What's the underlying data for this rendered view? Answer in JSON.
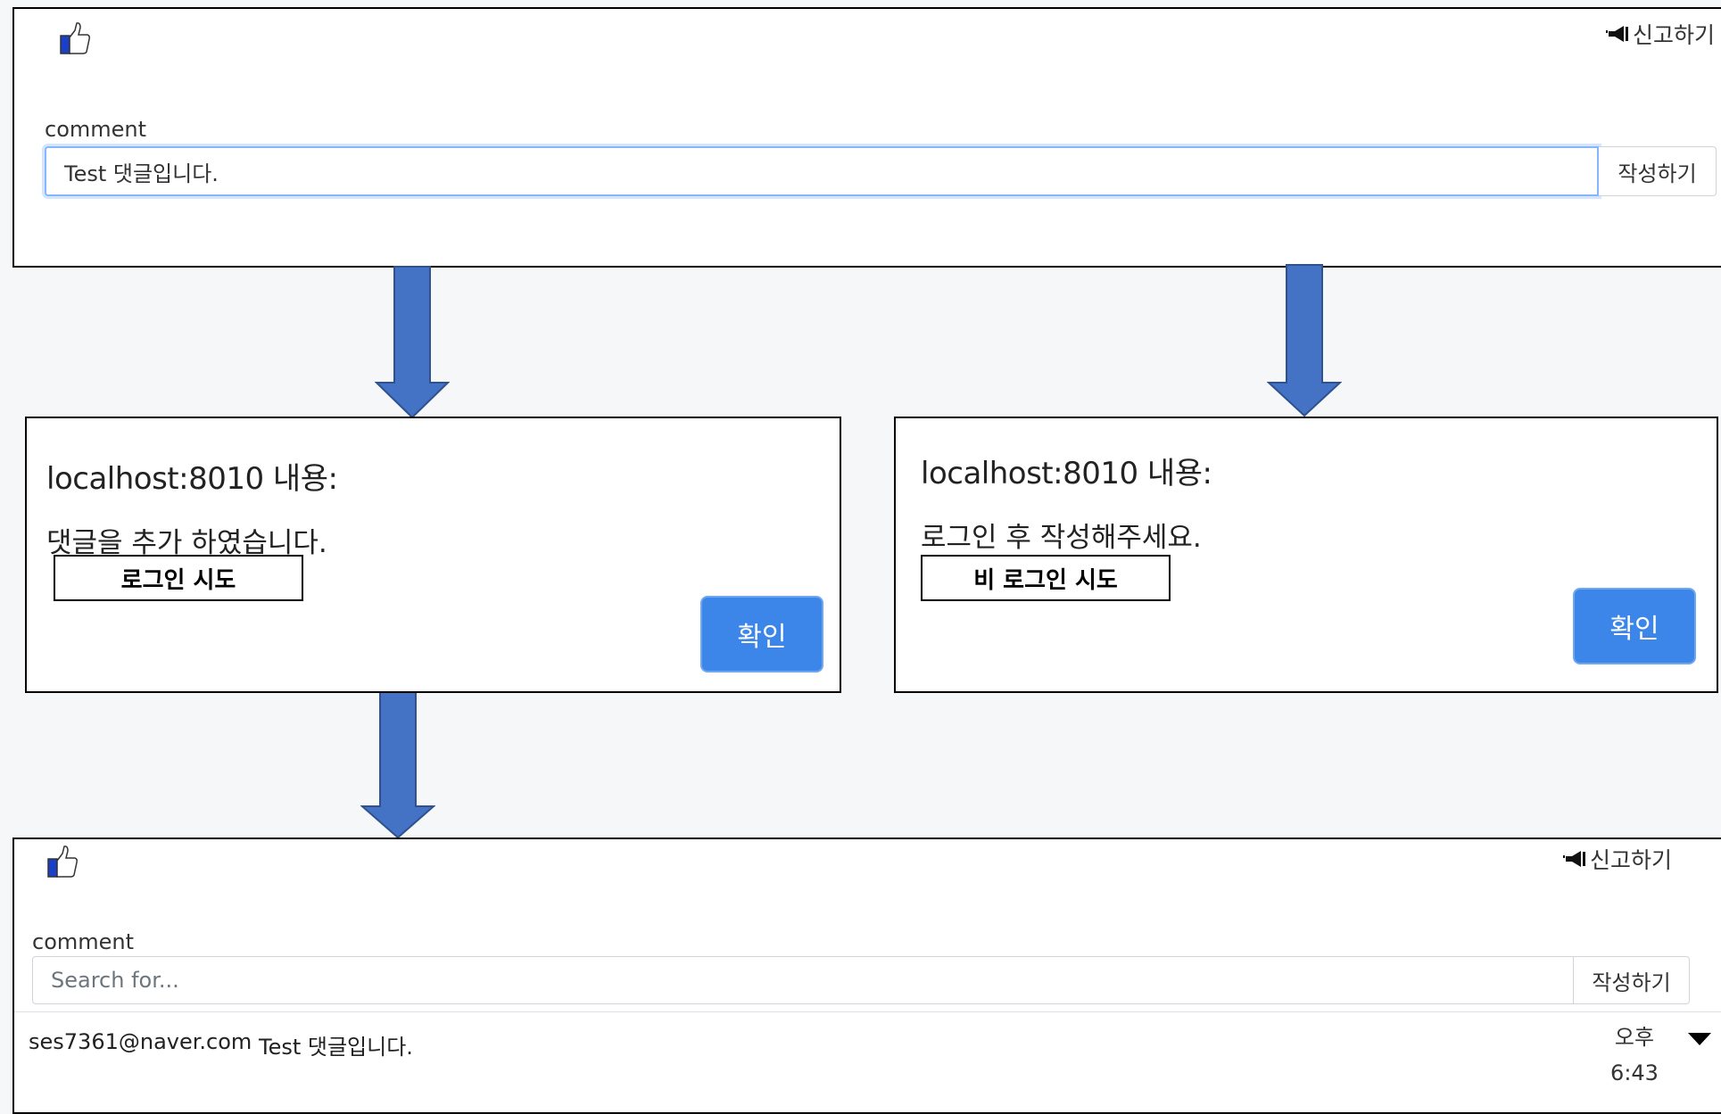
{
  "top_panel": {
    "report_label": "신고하기",
    "comment_label": "comment",
    "input_value": "Test 댓글입니다.",
    "submit_label": "작성하기"
  },
  "dialog_login": {
    "title": "localhost:8010 내용:",
    "message": "댓글을 추가 하였습니다.",
    "tag": "로그인 시도",
    "ok_label": "확인"
  },
  "dialog_guest": {
    "title": "localhost:8010 내용:",
    "message": "로그인 후 작성해주세요.",
    "tag": "비 로그인 시도",
    "ok_label": "확인"
  },
  "bottom_panel": {
    "report_label": "신고하기",
    "comment_label": "comment",
    "input_placeholder": "Search for...",
    "submit_label": "작성하기",
    "comment_row": {
      "author": "ses7361@naver.com",
      "text": "Test 댓글입니다.",
      "time_period": "오후",
      "time": "6:43"
    }
  },
  "colors": {
    "accent": "#3b86e8",
    "arrow": "#4472c4",
    "thumb_fill": "#1a3fc9"
  }
}
